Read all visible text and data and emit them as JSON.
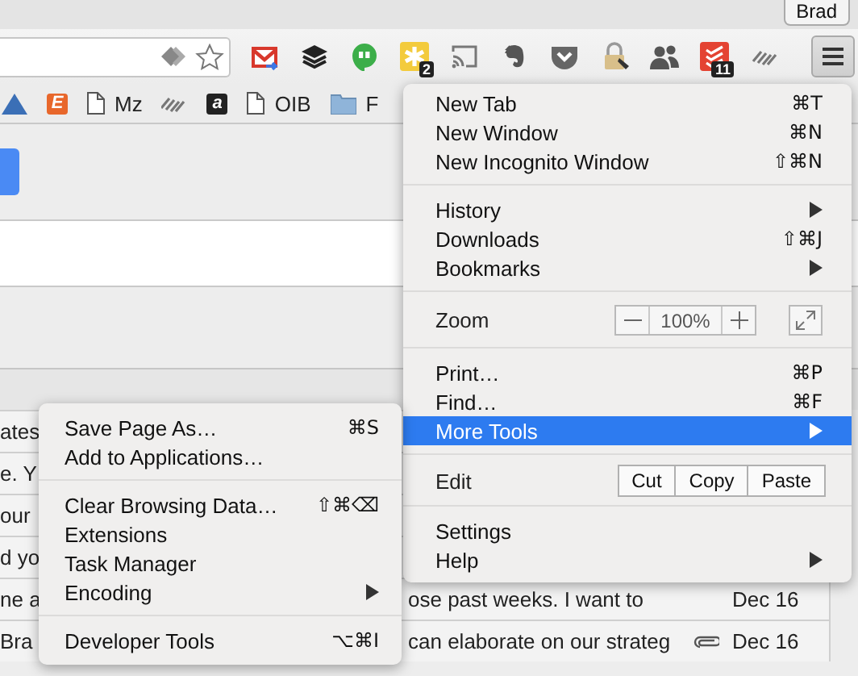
{
  "profile": {
    "name": "Brad"
  },
  "toolbar": {
    "extensions": [
      {
        "kind": "mail"
      },
      {
        "kind": "stack"
      },
      {
        "kind": "chat"
      },
      {
        "kind": "asterisk",
        "badge": "2"
      },
      {
        "kind": "cast"
      },
      {
        "kind": "elephant"
      },
      {
        "kind": "pocket"
      },
      {
        "kind": "padlock"
      },
      {
        "kind": "people"
      },
      {
        "kind": "checklist",
        "badge": "11"
      },
      {
        "kind": "stripes"
      }
    ]
  },
  "bookmarks": [
    {
      "kind": "triangle"
    },
    {
      "kind": "tile",
      "glyph": "E",
      "color": "#e8672b"
    },
    {
      "kind": "page",
      "label": "Mz"
    },
    {
      "kind": "stripes"
    },
    {
      "kind": "tile",
      "glyph": "a",
      "color": "#222222"
    },
    {
      "kind": "page",
      "label": "OIB"
    },
    {
      "kind": "folder",
      "label": "F"
    }
  ],
  "messages": [
    {
      "sender": "ates"
    },
    {
      "sender": "e. Y"
    },
    {
      "sender": "our"
    },
    {
      "sender": "d yo"
    },
    {
      "sender": "ne a",
      "snippet": "ose past weeks. I want to",
      "attachment": false,
      "date": "Dec 16"
    },
    {
      "sender": "Bra",
      "snippet": "can elaborate on our strateg",
      "attachment": true,
      "date": "Dec 16"
    }
  ],
  "main_menu": {
    "groups": [
      {
        "items": [
          {
            "kind": "item",
            "label": "New Tab",
            "shortcut": "⌘T",
            "submenu": false,
            "selected": false
          },
          {
            "kind": "item",
            "label": "New Window",
            "shortcut": "⌘N",
            "submenu": false,
            "selected": false
          },
          {
            "kind": "item",
            "label": "New Incognito Window",
            "shortcut": "⇧⌘N",
            "submenu": false,
            "selected": false
          }
        ]
      },
      {
        "items": [
          {
            "kind": "item",
            "label": "History",
            "submenu": true,
            "selected": false
          },
          {
            "kind": "item",
            "label": "Downloads",
            "shortcut": "⇧⌘J",
            "submenu": false,
            "selected": false
          },
          {
            "kind": "item",
            "label": "Bookmarks",
            "submenu": true,
            "selected": false
          }
        ]
      },
      {
        "items": [
          {
            "kind": "zoom",
            "label": "Zoom",
            "value": "100%"
          }
        ]
      },
      {
        "items": [
          {
            "kind": "item",
            "label": "Print…",
            "shortcut": "⌘P",
            "submenu": false,
            "selected": false
          },
          {
            "kind": "item",
            "label": "Find…",
            "shortcut": "⌘F",
            "submenu": false,
            "selected": false
          },
          {
            "kind": "item",
            "label": "More Tools",
            "submenu": true,
            "selected": true
          }
        ]
      },
      {
        "items": [
          {
            "kind": "edit",
            "label": "Edit",
            "buttons": [
              "Cut",
              "Copy",
              "Paste"
            ]
          }
        ]
      },
      {
        "items": [
          {
            "kind": "item",
            "label": "Settings",
            "submenu": false,
            "selected": false
          },
          {
            "kind": "item",
            "label": "Help",
            "submenu": true,
            "selected": false
          }
        ]
      }
    ]
  },
  "submenu": {
    "groups": [
      {
        "items": [
          {
            "kind": "item",
            "label": "Save Page As…",
            "shortcut": "⌘S",
            "submenu": false,
            "selected": false
          },
          {
            "kind": "item",
            "label": "Add to Applications…",
            "submenu": false,
            "selected": false
          }
        ]
      },
      {
        "items": [
          {
            "kind": "item",
            "label": "Clear Browsing Data…",
            "shortcut": "⇧⌘⌫",
            "submenu": false,
            "selected": false
          },
          {
            "kind": "item",
            "label": "Extensions",
            "submenu": false,
            "selected": false
          },
          {
            "kind": "item",
            "label": "Task Manager",
            "submenu": false,
            "selected": false
          },
          {
            "kind": "item",
            "label": "Encoding",
            "submenu": true,
            "selected": false
          }
        ]
      },
      {
        "items": [
          {
            "kind": "item",
            "label": "Developer Tools",
            "shortcut": "⌥⌘I",
            "submenu": false,
            "selected": false
          }
        ]
      }
    ]
  }
}
